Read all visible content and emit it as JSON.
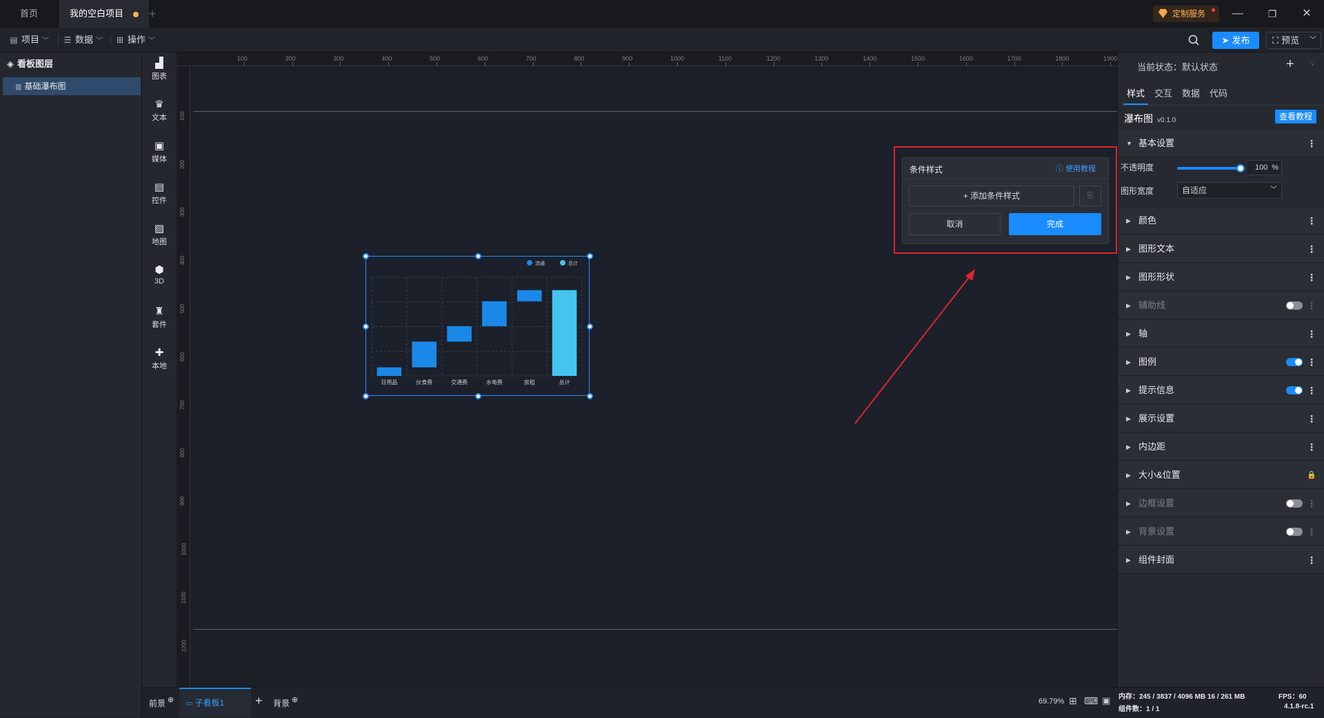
{
  "titlebar": {
    "tabs": [
      {
        "label": "首页"
      },
      {
        "label": "我的空白项目"
      }
    ],
    "add_tab": "+",
    "custom_service": "定制服务",
    "window": {
      "minimize": "—",
      "restore": "❐",
      "close": "✕"
    }
  },
  "toolbar": {
    "menus": [
      {
        "label": "项目",
        "icon": "file-icon"
      },
      {
        "label": "数据",
        "icon": "database-icon"
      },
      {
        "label": "操作",
        "icon": "grid-icon"
      }
    ],
    "publish": "发布",
    "preview": "预览"
  },
  "layers": {
    "title": "看板图层",
    "items": [
      {
        "label": "基础瀑布图"
      }
    ]
  },
  "components": [
    {
      "label": "图表",
      "icon": "chart-icon"
    },
    {
      "label": "文本",
      "icon": "text-icon"
    },
    {
      "label": "媒体",
      "icon": "media-icon"
    },
    {
      "label": "控件",
      "icon": "widget-icon"
    },
    {
      "label": "地图",
      "icon": "map-icon"
    },
    {
      "label": "3D",
      "icon": "cube-icon"
    },
    {
      "label": "套件",
      "icon": "kit-icon"
    },
    {
      "label": "本地",
      "icon": "puzzle-icon"
    }
  ],
  "ruler": {
    "top": [
      "100",
      "200",
      "300",
      "400",
      "500",
      "600",
      "700",
      "800",
      "900",
      "1000",
      "1100",
      "1200",
      "1300",
      "1400",
      "1500",
      "1600",
      "1700",
      "1800",
      "1900"
    ],
    "left": [
      "100",
      "200",
      "300",
      "400",
      "500",
      "600",
      "700",
      "800",
      "900",
      "1000",
      "1100",
      "1200"
    ]
  },
  "chart_data": {
    "type": "bar",
    "categories": [
      "日用品",
      "伙食费",
      "交通费",
      "水电费",
      "房租",
      "总计"
    ],
    "series": [
      {
        "name": "流通",
        "base": [
          0,
          10,
          40,
          58,
          87
        ],
        "values": [
          10,
          30,
          18,
          29,
          13
        ]
      },
      {
        "name": "总计",
        "base": [
          0
        ],
        "values": [
          100
        ]
      }
    ],
    "ylim": [
      0,
      115
    ],
    "grid": true,
    "legend": "top-right",
    "colors": {
      "flow": "#1a88e8",
      "total": "#44c4ee"
    }
  },
  "popup": {
    "title": "条件样式",
    "help": "使用教程",
    "add": "+ 添加条件样式",
    "cancel": "取消",
    "confirm": "完成"
  },
  "panel": {
    "state_label": "当前状态：默认状态",
    "tabs": [
      "样式",
      "交互",
      "数据",
      "代码"
    ],
    "component_name": "瀑布图",
    "version": "v0.1.0",
    "tutorial": "查看教程",
    "basic": "基本设置",
    "opacity_label": "不透明度",
    "opacity_value": "100",
    "opacity_unit": "%",
    "opacity_fraction": 1.0,
    "width_label": "图形宽度",
    "width_value": "自适应",
    "sections": [
      {
        "label": "颜色",
        "control": "more"
      },
      {
        "label": "图形文本",
        "control": "more"
      },
      {
        "label": "图形形状",
        "control": "more"
      },
      {
        "label": "辅助线",
        "control": "toggle-off",
        "dim": true
      },
      {
        "label": "轴",
        "control": "more"
      },
      {
        "label": "图例",
        "control": "toggle-on"
      },
      {
        "label": "提示信息",
        "control": "toggle-on"
      },
      {
        "label": "展示设置",
        "control": "more"
      },
      {
        "label": "内边距",
        "control": "more"
      },
      {
        "label": "大小&位置",
        "control": "lock"
      },
      {
        "label": "边框设置",
        "control": "toggle-off",
        "dim": true
      },
      {
        "label": "背景设置",
        "control": "toggle-off",
        "dim": true
      },
      {
        "label": "组件封面",
        "control": "more"
      }
    ]
  },
  "statusbar": {
    "foreground": "前景",
    "sub_board": "子看板1",
    "background": "背景",
    "zoom": "69.79%",
    "memory": "内存：245 / 3837 / 4096 MB  16 / 261 MB",
    "fps": "FPS：60",
    "component_count": "组件数：1 / 1",
    "version": "4.1.8-rc.1"
  }
}
